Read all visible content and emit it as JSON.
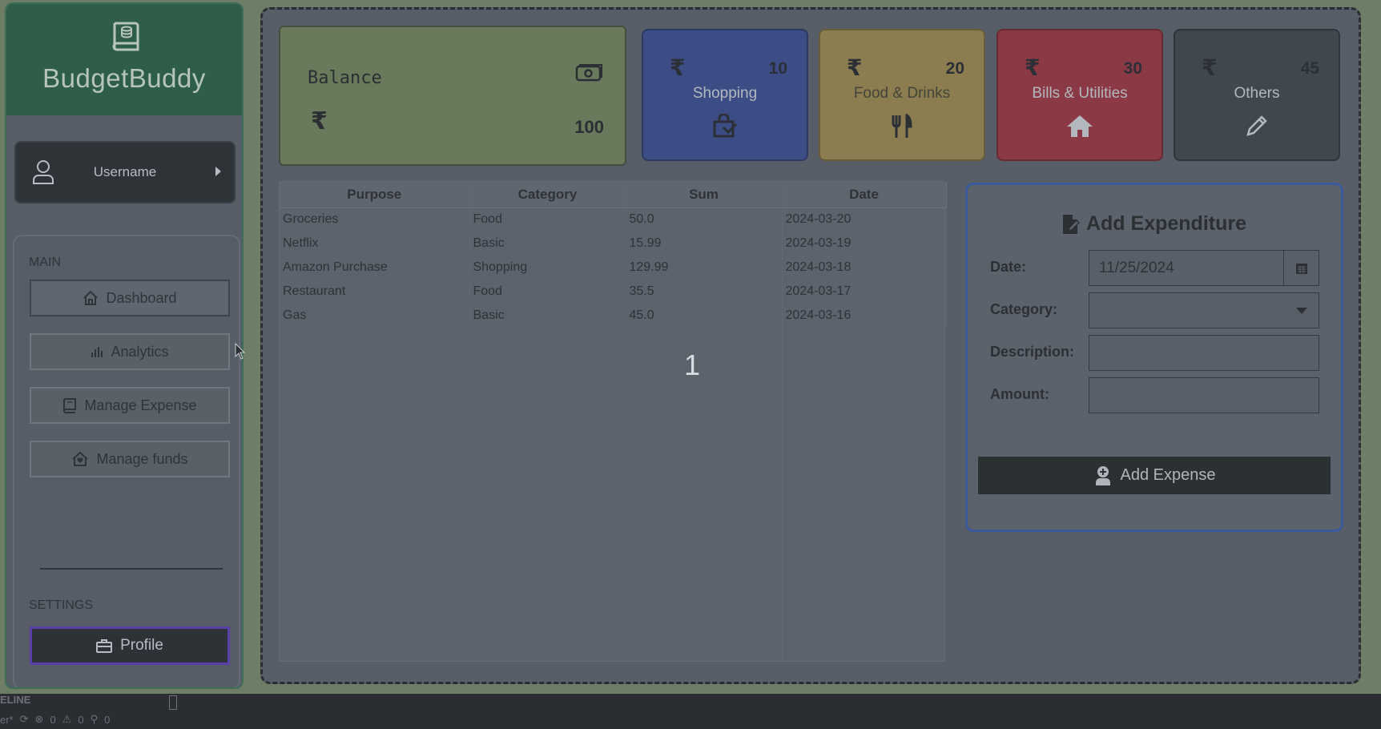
{
  "app": {
    "name": "BudgetBuddy"
  },
  "user": {
    "name": "Username"
  },
  "sidebar": {
    "main_label": "MAIN",
    "items": [
      {
        "label": "Dashboard",
        "icon": "home-icon",
        "active": true
      },
      {
        "label": "Analytics",
        "icon": "bar-chart-icon"
      },
      {
        "label": "Manage Expense",
        "icon": "book-icon"
      },
      {
        "label": "Manage funds",
        "icon": "house-heart-icon"
      }
    ],
    "settings_label": "SETTINGS",
    "profile_label": "Profile"
  },
  "balance": {
    "title": "Balance",
    "currency": "₹",
    "amount": "100"
  },
  "categories": [
    {
      "label": "Shopping",
      "currency": "₹",
      "count": "10",
      "icon": "shopping-bag-icon",
      "color": "#3b4d84"
    },
    {
      "label": "Food & Drinks",
      "currency": "₹",
      "count": "20",
      "icon": "fork-knife-icon",
      "color": "#8b7d4f"
    },
    {
      "label": "Bills & Utilities",
      "currency": "₹",
      "count": "30",
      "icon": "house-icon",
      "color": "#8b3a45"
    },
    {
      "label": "Others",
      "currency": "₹",
      "count": "45",
      "icon": "pencil-icon",
      "color": "#3f474f"
    }
  ],
  "table": {
    "headers": [
      "Purpose",
      "Category",
      "Sum",
      "Date"
    ],
    "rows": [
      [
        "Groceries",
        "Food",
        "50.0",
        "2024-03-20"
      ],
      [
        "Netflix",
        "Basic",
        "15.99",
        "2024-03-19"
      ],
      [
        "Amazon Purchase",
        "Shopping",
        "129.99",
        "2024-03-18"
      ],
      [
        "Restaurant",
        "Food",
        "35.5",
        "2024-03-17"
      ],
      [
        "Gas",
        "Basic",
        "45.0",
        "2024-03-16"
      ]
    ]
  },
  "page_indicator": "1",
  "form": {
    "title": "Add Expenditure",
    "date_label": "Date:",
    "date_value": "11/25/2024",
    "category_label": "Category:",
    "category_value": "",
    "description_label": "Description:",
    "description_value": "",
    "amount_label": "Amount:",
    "amount_value": "",
    "submit_label": "Add Expense"
  },
  "statusbar": {
    "line1": "ELINE",
    "branch": "er*",
    "errors": "0",
    "warnings": "0",
    "ports": "0"
  }
}
